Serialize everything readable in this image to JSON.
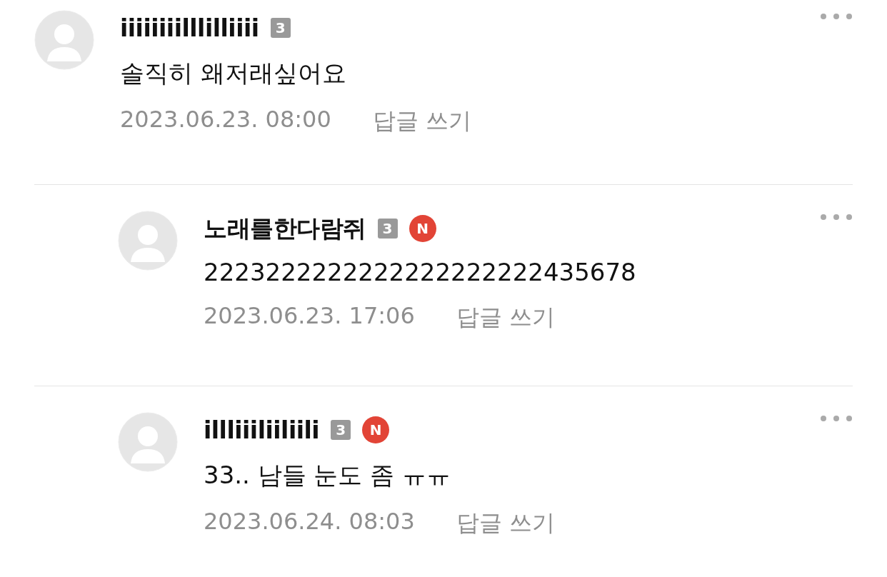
{
  "comments": [
    {
      "name": "iiiiiiiilllilliiii",
      "level_badge": "3",
      "text": "솔직히 왜저래싶어요",
      "date": "2023.06.23. 08:00",
      "reply_link": "답글 쓰기",
      "replies": [
        {
          "name": "노래를한다람쥐",
          "level_badge": "3",
          "new_badge": "N",
          "text": "2223222222222222222222435678",
          "date": "2023.06.23. 17:06",
          "reply_link": "답글 쓰기"
        },
        {
          "name": "illliiiliiliili",
          "level_badge": "3",
          "new_badge": "N",
          "text": "33.. 남들 눈도 좀 ㅠㅠ",
          "date": "2023.06.24. 08:03",
          "reply_link": "답글 쓰기"
        }
      ]
    }
  ]
}
